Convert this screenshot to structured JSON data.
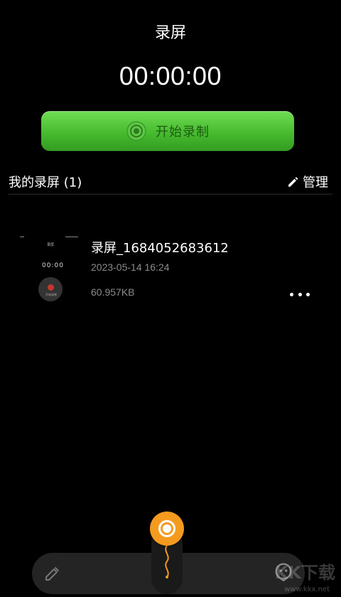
{
  "header": {
    "title": "录屏",
    "timer": "00:00:00"
  },
  "record_button": {
    "label": "开始录制",
    "icon": "record-icon"
  },
  "recordings_section": {
    "title": "我的录屏 (1)",
    "manage_label": "管理",
    "manage_icon": "pencil-icon"
  },
  "recordings": [
    {
      "name": "录屏_1684052683612",
      "date": "2023-05-14 16:24",
      "size": "60.957KB",
      "thumbnail": {
        "text_top": "录屏",
        "text_mid": "00:00",
        "text_sub": "开始录制"
      },
      "more_icon": "more-dots-icon"
    }
  ],
  "bottom_bar": {
    "left_icon": "pencil-icon",
    "center_icon": "float-record-icon",
    "right_icon": "face-icon"
  },
  "watermark": {
    "main": "KK下载",
    "sub": "www.kkx.net"
  },
  "colors": {
    "accent_green": "#47bb2f",
    "accent_orange": "#f39a1f",
    "background": "#000000"
  }
}
